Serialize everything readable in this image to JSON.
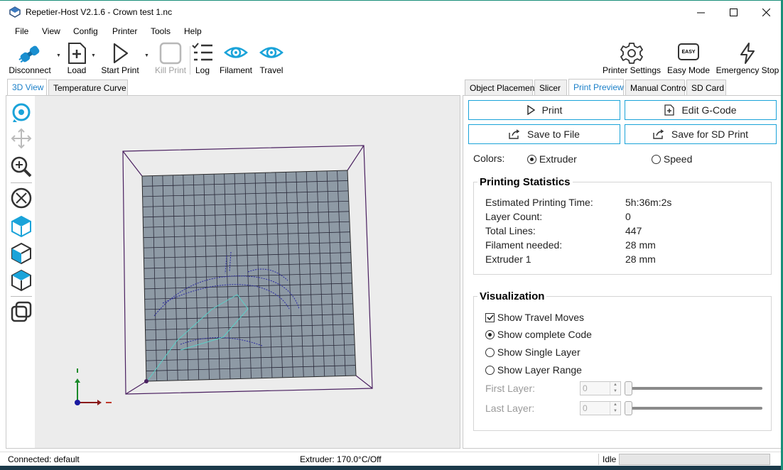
{
  "window": {
    "title": "Repetier-Host V2.1.6 - Crown test 1.nc",
    "minimize": "—",
    "maximize": "☐",
    "close": "✕"
  },
  "menu": [
    "File",
    "View",
    "Config",
    "Printer",
    "Tools",
    "Help"
  ],
  "toolbar": {
    "disconnect": "Disconnect",
    "load": "Load",
    "start_print": "Start Print",
    "kill_print": "Kill Print",
    "log": "Log",
    "filament": "Filament",
    "travel": "Travel",
    "printer_settings": "Printer Settings",
    "easy_mode": "Easy Mode",
    "easy_badge": "EASY",
    "emergency_stop": "Emergency Stop"
  },
  "left_tabs": [
    "3D View",
    "Temperature Curve"
  ],
  "right_tabs": [
    "Object Placement",
    "Slicer",
    "Print Preview",
    "Manual Control",
    "SD Card"
  ],
  "preview": {
    "print": "Print",
    "edit_gcode": "Edit G-Code",
    "save_to_file": "Save to File",
    "save_sd": "Save for SD Print",
    "colors_label": "Colors:",
    "color_extruder": "Extruder",
    "color_speed": "Speed"
  },
  "stats": {
    "title": "Printing Statistics",
    "rows": [
      {
        "label": "Estimated Printing Time:",
        "value": "5h:36m:2s"
      },
      {
        "label": "Layer Count:",
        "value": "0"
      },
      {
        "label": "Total Lines:",
        "value": "447"
      },
      {
        "label": "Filament needed:",
        "value": "28 mm"
      },
      {
        "label": "Extruder 1",
        "value": "28 mm"
      }
    ]
  },
  "visualization": {
    "title": "Visualization",
    "show_travel": "Show Travel Moves",
    "show_complete": "Show complete Code",
    "show_single": "Show Single Layer",
    "show_range": "Show Layer Range",
    "first_layer": "First Layer:",
    "last_layer": "Last Layer:",
    "first_value": "0",
    "last_value": "0"
  },
  "status": {
    "connection": "Connected: default",
    "extruder": "Extruder: 170.0°C/Off",
    "state": "Idle"
  },
  "colors": {
    "accent": "#1aa3d9",
    "bed": "#8e9aa5",
    "frame": "#4a2060"
  }
}
